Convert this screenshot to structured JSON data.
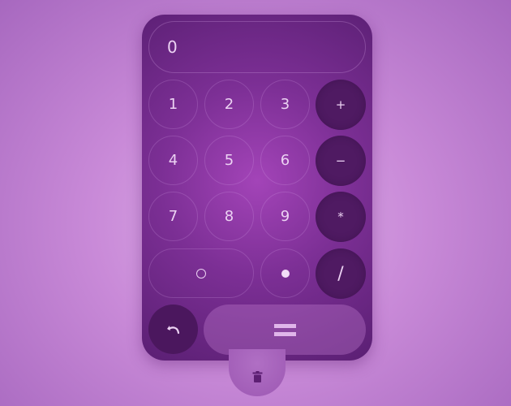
{
  "display": {
    "value": "0"
  },
  "keys": {
    "one": "1",
    "two": "2",
    "three": "3",
    "four": "4",
    "five": "5",
    "six": "6",
    "seven": "7",
    "eight": "8",
    "nine": "9",
    "plus": "+",
    "minus": "−",
    "multiply": "*",
    "divide": "/"
  },
  "icons": {
    "zero": "ring-glyph",
    "decimal": "dot-glyph",
    "undo": "undo-icon",
    "equals": "equals-icon",
    "clear": "trash-icon"
  },
  "colors": {
    "background": "#c98ad8",
    "calculator_body": "#7c2f95",
    "operator_key": "#4f1a62",
    "text": "#ecd2f3"
  }
}
